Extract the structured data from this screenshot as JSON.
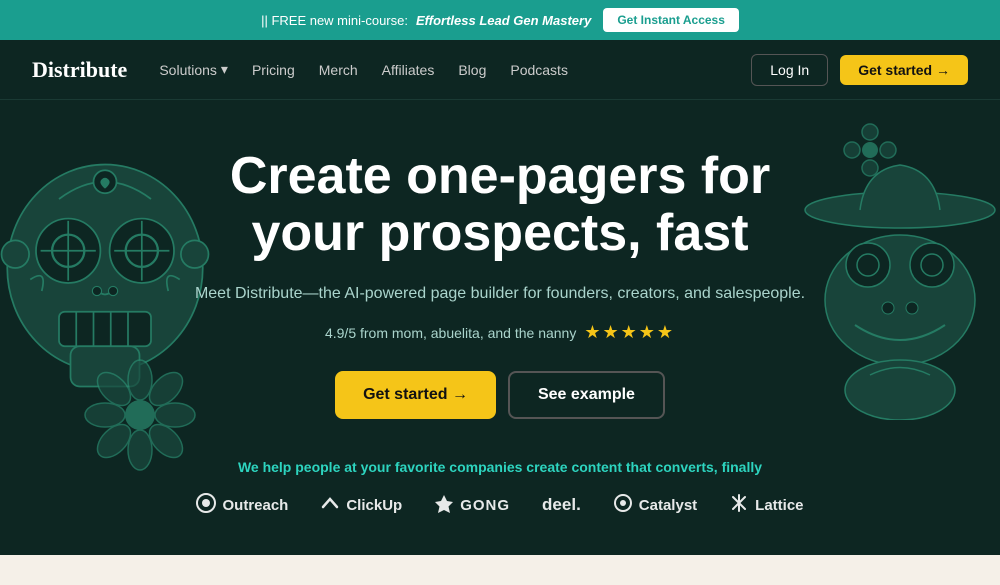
{
  "banner": {
    "prefix": "|| FREE new mini-course:",
    "course_name": "Effortless Lead Gen Mastery",
    "cta_label": "Get Instant Access"
  },
  "navbar": {
    "logo": "Distribute",
    "links": [
      {
        "label": "Solutions",
        "has_dropdown": true
      },
      {
        "label": "Pricing"
      },
      {
        "label": "Merch"
      },
      {
        "label": "Affiliates"
      },
      {
        "label": "Blog"
      },
      {
        "label": "Podcasts"
      }
    ],
    "login_label": "Log In",
    "started_label": "Get started →"
  },
  "hero": {
    "title": "Create one-pagers for your prospects, fast",
    "subtitle": "Meet Distribute—the AI-powered page builder for founders, creators, and salespeople.",
    "rating_text": "4.9/5 from mom, abuelita, and the nanny",
    "stars": "★★★★★",
    "btn_primary": "Get started →",
    "btn_secondary": "See example"
  },
  "partners": {
    "tagline": "We help people at your favorite companies create content that converts, finally",
    "logos": [
      {
        "name": "Outreach",
        "icon": "◎"
      },
      {
        "name": "ClickUp",
        "icon": "↻"
      },
      {
        "name": "GONG",
        "icon": "⚡"
      },
      {
        "name": "deel.",
        "icon": ""
      },
      {
        "name": "Catalyst",
        "icon": "◎"
      },
      {
        "name": "Lattice",
        "icon": "❋"
      }
    ]
  }
}
